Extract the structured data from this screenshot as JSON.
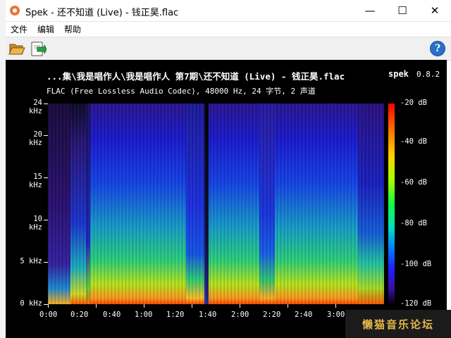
{
  "window": {
    "title": "Spek - 还不知道 (Live) - 钱正昊.flac",
    "minimize_glyph": "—",
    "maximize_glyph": "☐",
    "close_glyph": "✕"
  },
  "menu": {
    "items": [
      {
        "label": "文件"
      },
      {
        "label": "编辑"
      },
      {
        "label": "帮助"
      }
    ]
  },
  "toolbar": {
    "open_icon": "folder-open-icon",
    "save_icon": "save-export-icon",
    "help_label": "?"
  },
  "plot": {
    "title": "...集\\我是唱作人\\我是唱作人 第7期\\还不知道 (Live) - 钱正昊.flac",
    "app_name": "spek",
    "app_version": "0.8.2",
    "info": "FLAC (Free Lossless Audio Codec), 48000 Hz, 24 字节, 2 声道",
    "y_axis_labels": [
      "24 kHz",
      "20 kHz",
      "15 kHz",
      "10 kHz",
      "5 kHz",
      "0 kHz"
    ],
    "x_axis_labels": [
      "0:00",
      "0:20",
      "0:40",
      "1:00",
      "1:20",
      "1:40",
      "2:00",
      "2:20",
      "2:40",
      "3:00"
    ],
    "colorbar_labels": [
      "-20 dB",
      "-40 dB",
      "-60 dB",
      "-80 dB",
      "-100 dB",
      "-120 dB"
    ]
  },
  "watermark": {
    "text": "懒猫音乐论坛"
  }
}
